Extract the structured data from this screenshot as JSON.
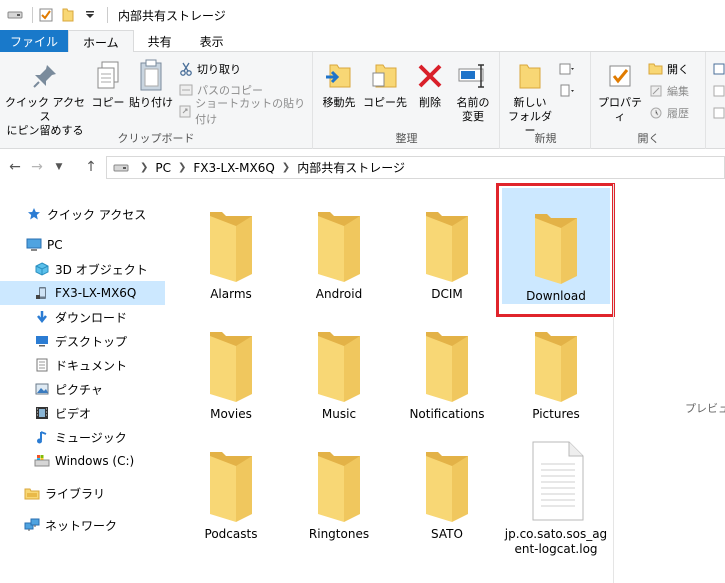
{
  "titlebar": {
    "title": "内部共有ストレージ",
    "icons": [
      "drive-icon",
      "checkbox-icon",
      "folder-icon",
      "dropdown-icon"
    ]
  },
  "tabs": [
    {
      "label": "ファイル"
    },
    {
      "label": "ホーム"
    },
    {
      "label": "共有"
    },
    {
      "label": "表示"
    }
  ],
  "ribbon": {
    "clipboard": {
      "label": "クリップボード",
      "pin_line1": "クイック アクセス",
      "pin_line2": "にピン留めする",
      "copy": "コピー",
      "paste": "貼り付け",
      "cut": "切り取り",
      "copy_path": "パスのコピー",
      "paste_shortcut": "ショートカットの貼り付け"
    },
    "organize": {
      "label": "整理",
      "move_to": "移動先",
      "copy_to": "コピー先",
      "delete": "削除",
      "rename_line1": "名前の",
      "rename_line2": "変更"
    },
    "new": {
      "label": "新規",
      "new_folder_line1": "新しい",
      "new_folder_line2": "フォルダー"
    },
    "open": {
      "label": "開く",
      "properties": "プロパティ",
      "open": "開く",
      "edit": "編集",
      "history": "履歴"
    }
  },
  "address": {
    "crumbs": [
      "PC",
      "FX3-LX-MX6Q",
      "内部共有ストレージ"
    ]
  },
  "nav": {
    "items": [
      {
        "label": "クイック アクセス"
      },
      {
        "label": "PC"
      },
      {
        "label": "3D オブジェクト"
      },
      {
        "label": "FX3-LX-MX6Q"
      },
      {
        "label": "ダウンロード"
      },
      {
        "label": "デスクトップ"
      },
      {
        "label": "ドキュメント"
      },
      {
        "label": "ピクチャ"
      },
      {
        "label": "ビデオ"
      },
      {
        "label": "ミュージック"
      },
      {
        "label": "Windows (C:)"
      },
      {
        "label": "ライブラリ"
      },
      {
        "label": "ネットワーク"
      }
    ]
  },
  "files": [
    {
      "name": "Alarms",
      "type": "folder"
    },
    {
      "name": "Android",
      "type": "folder"
    },
    {
      "name": "DCIM",
      "type": "folder"
    },
    {
      "name": "Download",
      "type": "folder"
    },
    {
      "name": "Movies",
      "type": "folder"
    },
    {
      "name": "Music",
      "type": "folder"
    },
    {
      "name": "Notifications",
      "type": "folder"
    },
    {
      "name": "Pictures",
      "type": "folder"
    },
    {
      "name": "Podcasts",
      "type": "folder"
    },
    {
      "name": "Ringtones",
      "type": "folder"
    },
    {
      "name": "SATO",
      "type": "folder"
    },
    {
      "name": "jp.co.sato.sos_agent-logcat.log",
      "line1": "jp.co.sato.sos_ag",
      "line2": "ent-logcat.log",
      "type": "file"
    }
  ],
  "preview_text": "プレビュー",
  "colors": {
    "file_tab": "#1979ca",
    "selection": "#cce8ff",
    "highlight": "#e0242b",
    "folder": "#f8d775"
  }
}
